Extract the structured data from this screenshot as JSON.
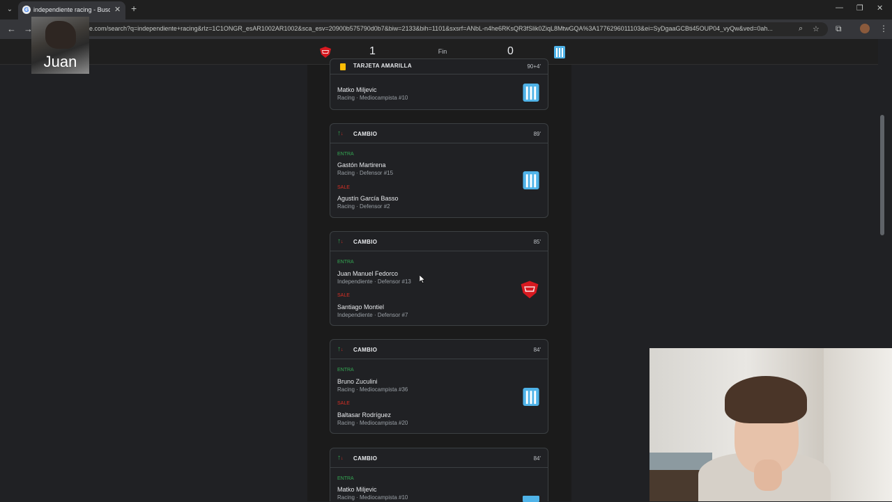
{
  "browser": {
    "tab_title": "independiente racing - Buscar c",
    "url": "e.com/search?q=independiente+racing&rlz=1C1ONGR_esAR1002AR1002&sca_esv=20900b575790d0b7&biw=2133&bih=1101&sxsrf=ANbL-n4he6RKsQR3fSlik0ZiqL8MtwGQA%3A1776296011103&ei=SyDgaaGCBti45OUP04_vyQw&ved=0ah..."
  },
  "overlay": {
    "name": "Juan"
  },
  "score": {
    "home_score": "1",
    "status": "Fin",
    "away_score": "0"
  },
  "events": [
    {
      "type": "TARJETA AMARILLA",
      "minute": "90+4'",
      "player": "Matko Miljevic",
      "meta": "Racing · Mediocampista #10"
    },
    {
      "type": "CAMBIO",
      "minute": "89'",
      "in_label": "ENTRA",
      "in_player": "Gastón Martirena",
      "in_meta": "Racing · Defensor #15",
      "out_label": "SALE",
      "out_player": "Agustín García Basso",
      "out_meta": "Racing · Defensor #2"
    },
    {
      "type": "CAMBIO",
      "minute": "85'",
      "in_label": "ENTRA",
      "in_player": "Juan Manuel Fedorco",
      "in_meta": "Independiente · Defensor #13",
      "out_label": "SALE",
      "out_player": "Santiago Montiel",
      "out_meta": "Independiente · Defensor #7"
    },
    {
      "type": "CAMBIO",
      "minute": "84'",
      "in_label": "ENTRA",
      "in_player": "Bruno Zuculini",
      "in_meta": "Racing · Mediocampista #36",
      "out_label": "SALE",
      "out_player": "Baltasar Rodríguez",
      "out_meta": "Racing · Mediocampista #20"
    },
    {
      "type": "CAMBIO",
      "minute": "84'",
      "in_label": "ENTRA",
      "in_player": "Matko Miljevic",
      "in_meta": "Racing · Mediocampista #10"
    }
  ],
  "colors": {
    "independiente_red": "#d71920",
    "racing_blue": "#4fb3e8",
    "enter_green": "#34a853",
    "exit_red": "#d93025",
    "yellow_card": "#fbbc04"
  }
}
